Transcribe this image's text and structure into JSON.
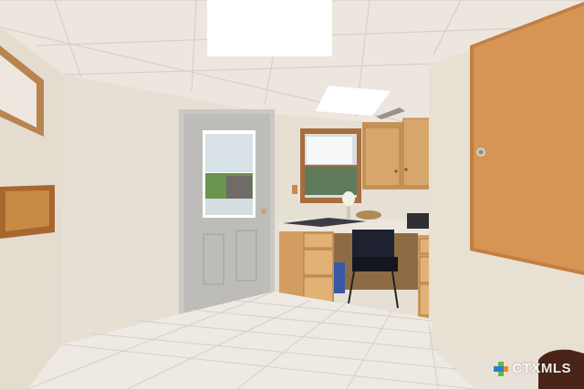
{
  "watermark": {
    "text": "CTXMLS",
    "colors": {
      "green": "#5db94a",
      "blue": "#2d7fc4",
      "orange": "#f08a24"
    }
  },
  "scene": {
    "description_items": [
      "ceiling-lights",
      "exterior-door",
      "window",
      "built-in-desk",
      "office-chair",
      "upper-cabinets",
      "wood-door",
      "wall-mirror",
      "wall-shelf",
      "tile-floor"
    ]
  }
}
